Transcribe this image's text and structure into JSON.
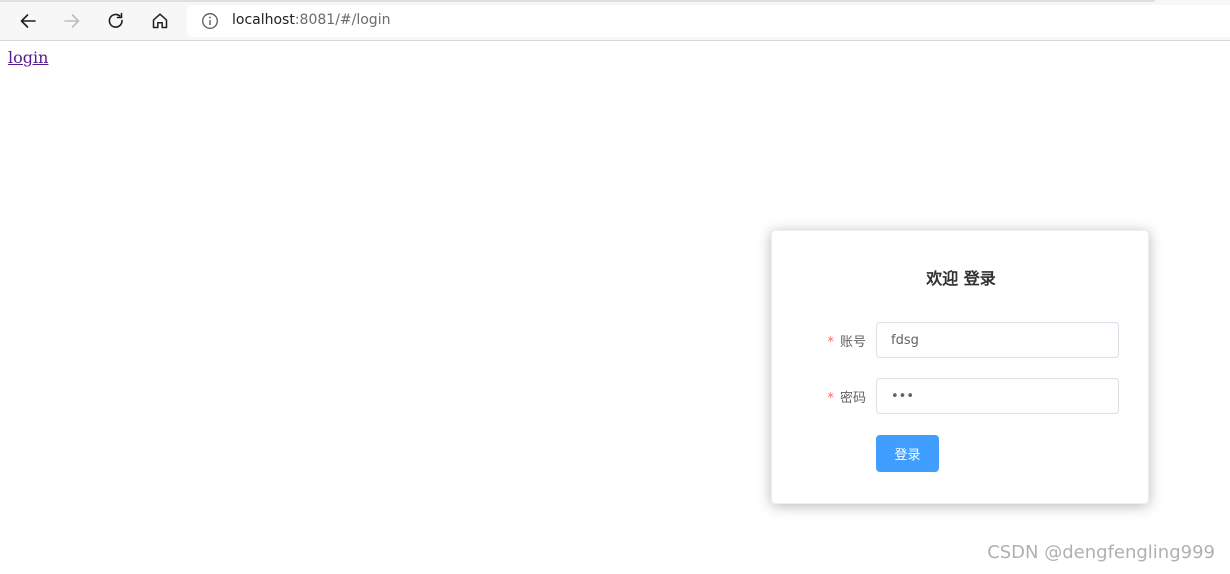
{
  "browser": {
    "url_host": "localhost",
    "url_rest": ":8081/#/login",
    "icons": {
      "back": "arrow-left-icon",
      "forward": "arrow-right-icon",
      "reload": "reload-icon",
      "home": "home-icon",
      "info": "info-icon"
    }
  },
  "page": {
    "link_text": "login"
  },
  "login_card": {
    "title": "欢迎 登录",
    "account": {
      "label": "账号",
      "required_mark": "*",
      "value": "fdsg"
    },
    "password": {
      "label": "密码",
      "required_mark": "*",
      "value": "123"
    },
    "submit_label": "登录"
  },
  "watermark": "CSDN @dengfengling999",
  "colors": {
    "primary": "#409eff",
    "required": "#f56c6c",
    "link_visited": "#551a8b"
  }
}
